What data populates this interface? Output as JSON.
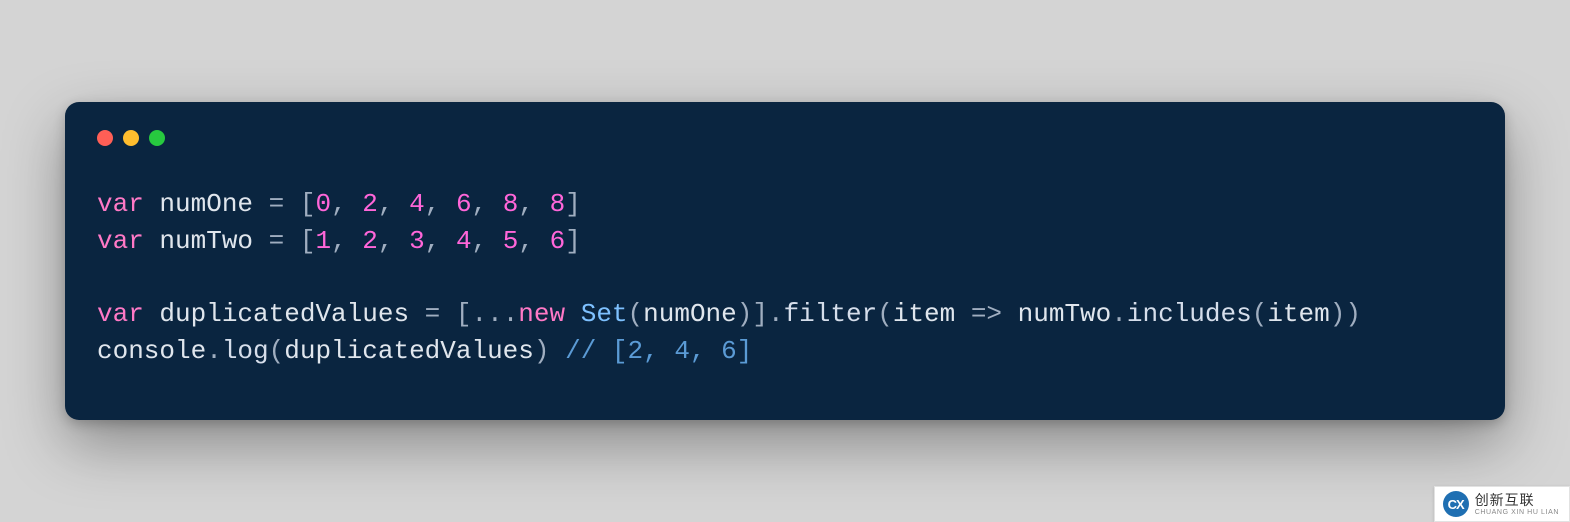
{
  "window": {
    "traffic": [
      "close",
      "minimize",
      "zoom"
    ]
  },
  "code": {
    "lines": [
      {
        "tokens": [
          {
            "t": "var ",
            "c": "kw"
          },
          {
            "t": "numOne ",
            "c": "id"
          },
          {
            "t": "= [",
            "c": "pn"
          },
          {
            "t": "0",
            "c": "num"
          },
          {
            "t": ", ",
            "c": "pn"
          },
          {
            "t": "2",
            "c": "num"
          },
          {
            "t": ", ",
            "c": "pn"
          },
          {
            "t": "4",
            "c": "num"
          },
          {
            "t": ", ",
            "c": "pn"
          },
          {
            "t": "6",
            "c": "num"
          },
          {
            "t": ", ",
            "c": "pn"
          },
          {
            "t": "8",
            "c": "num"
          },
          {
            "t": ", ",
            "c": "pn"
          },
          {
            "t": "8",
            "c": "num"
          },
          {
            "t": "]",
            "c": "pn"
          }
        ]
      },
      {
        "tokens": [
          {
            "t": "var ",
            "c": "kw"
          },
          {
            "t": "numTwo ",
            "c": "id"
          },
          {
            "t": "= [",
            "c": "pn"
          },
          {
            "t": "1",
            "c": "num"
          },
          {
            "t": ", ",
            "c": "pn"
          },
          {
            "t": "2",
            "c": "num"
          },
          {
            "t": ", ",
            "c": "pn"
          },
          {
            "t": "3",
            "c": "num"
          },
          {
            "t": ", ",
            "c": "pn"
          },
          {
            "t": "4",
            "c": "num"
          },
          {
            "t": ", ",
            "c": "pn"
          },
          {
            "t": "5",
            "c": "num"
          },
          {
            "t": ", ",
            "c": "pn"
          },
          {
            "t": "6",
            "c": "num"
          },
          {
            "t": "]",
            "c": "pn"
          }
        ]
      },
      {
        "tokens": [
          {
            "t": "",
            "c": "id"
          }
        ]
      },
      {
        "tokens": [
          {
            "t": "var ",
            "c": "kw"
          },
          {
            "t": "duplicatedValues ",
            "c": "id"
          },
          {
            "t": "= [",
            "c": "pn"
          },
          {
            "t": "...",
            "c": "pn"
          },
          {
            "t": "new ",
            "c": "kw"
          },
          {
            "t": "Set",
            "c": "cls"
          },
          {
            "t": "(",
            "c": "pn"
          },
          {
            "t": "numOne",
            "c": "id"
          },
          {
            "t": ")].",
            "c": "pn"
          },
          {
            "t": "filter",
            "c": "call"
          },
          {
            "t": "(",
            "c": "pn"
          },
          {
            "t": "item ",
            "c": "id"
          },
          {
            "t": "=> ",
            "c": "pn"
          },
          {
            "t": "numTwo",
            "c": "id"
          },
          {
            "t": ".",
            "c": "pn"
          },
          {
            "t": "includes",
            "c": "call"
          },
          {
            "t": "(",
            "c": "pn"
          },
          {
            "t": "item",
            "c": "id"
          },
          {
            "t": "))",
            "c": "pn"
          }
        ]
      },
      {
        "tokens": [
          {
            "t": "console",
            "c": "id"
          },
          {
            "t": ".",
            "c": "pn"
          },
          {
            "t": "log",
            "c": "call"
          },
          {
            "t": "(",
            "c": "pn"
          },
          {
            "t": "duplicatedValues",
            "c": "id"
          },
          {
            "t": ") ",
            "c": "pn"
          },
          {
            "t": "// [2, 4, 6]",
            "c": "cmt"
          }
        ]
      }
    ]
  },
  "watermark": {
    "abbr": "CX",
    "line1": "创新互联",
    "line2": "CHUANG XIN HU LIAN"
  }
}
